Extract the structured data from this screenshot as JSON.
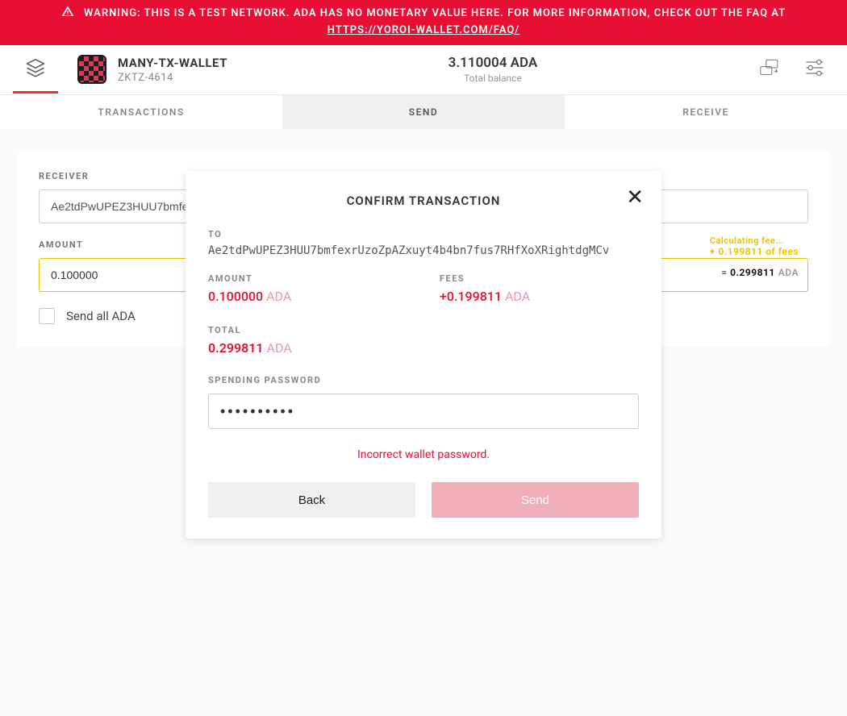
{
  "banner": {
    "text_prefix": "WARNING: THIS IS A TEST NETWORK. ADA HAS NO MONETARY VALUE HERE. FOR MORE INFORMATION, CHECK OUT THE FAQ AT ",
    "link_text": "HTTPS://YOROI-WALLET.COM/FAQ/"
  },
  "header": {
    "wallet_name": "MANY-TX-WALLET",
    "wallet_code": "ZKTZ-4614",
    "balance_value": "3.110004 ADA",
    "balance_label": "Total balance"
  },
  "tabs": {
    "transactions": "TRANSACTIONS",
    "send": "SEND",
    "receive": "RECEIVE",
    "active": "send"
  },
  "send_form": {
    "receiver_label": "RECEIVER",
    "receiver_value": "Ae2tdPwUPEZ3HUU7bmfe",
    "amount_label": "AMOUNT",
    "amount_value": "0.100000",
    "fee_hint_calc": "Calculating fee...",
    "fee_hint_value": "+ 0.199811 of fees",
    "eq_prefix": "= ",
    "eq_value": "0.299811",
    "eq_suffix": "ADA",
    "send_all_label": "Send all ADA"
  },
  "modal": {
    "title": "CONFIRM TRANSACTION",
    "to_label": "TO",
    "to_value": "Ae2tdPwUPEZ3HUU7bmfexrUzoZpAZxuyt4b4bn7fus7RHfXoXRightdgMCv",
    "amount_label": "AMOUNT",
    "amount_value": "0.100000",
    "amount_suffix": "ADA",
    "fees_label": "FEES",
    "fees_value": "+0.199811",
    "fees_suffix": "ADA",
    "total_label": "TOTAL",
    "total_value": "0.299811",
    "total_suffix": "ADA",
    "password_label": "SPENDING PASSWORD",
    "password_value": "••••••••••",
    "error": "Incorrect wallet password.",
    "back_label": "Back",
    "send_label": "Send"
  },
  "colors": {
    "brand_red": "#E71034",
    "warn_yellow": "#E6C200"
  }
}
